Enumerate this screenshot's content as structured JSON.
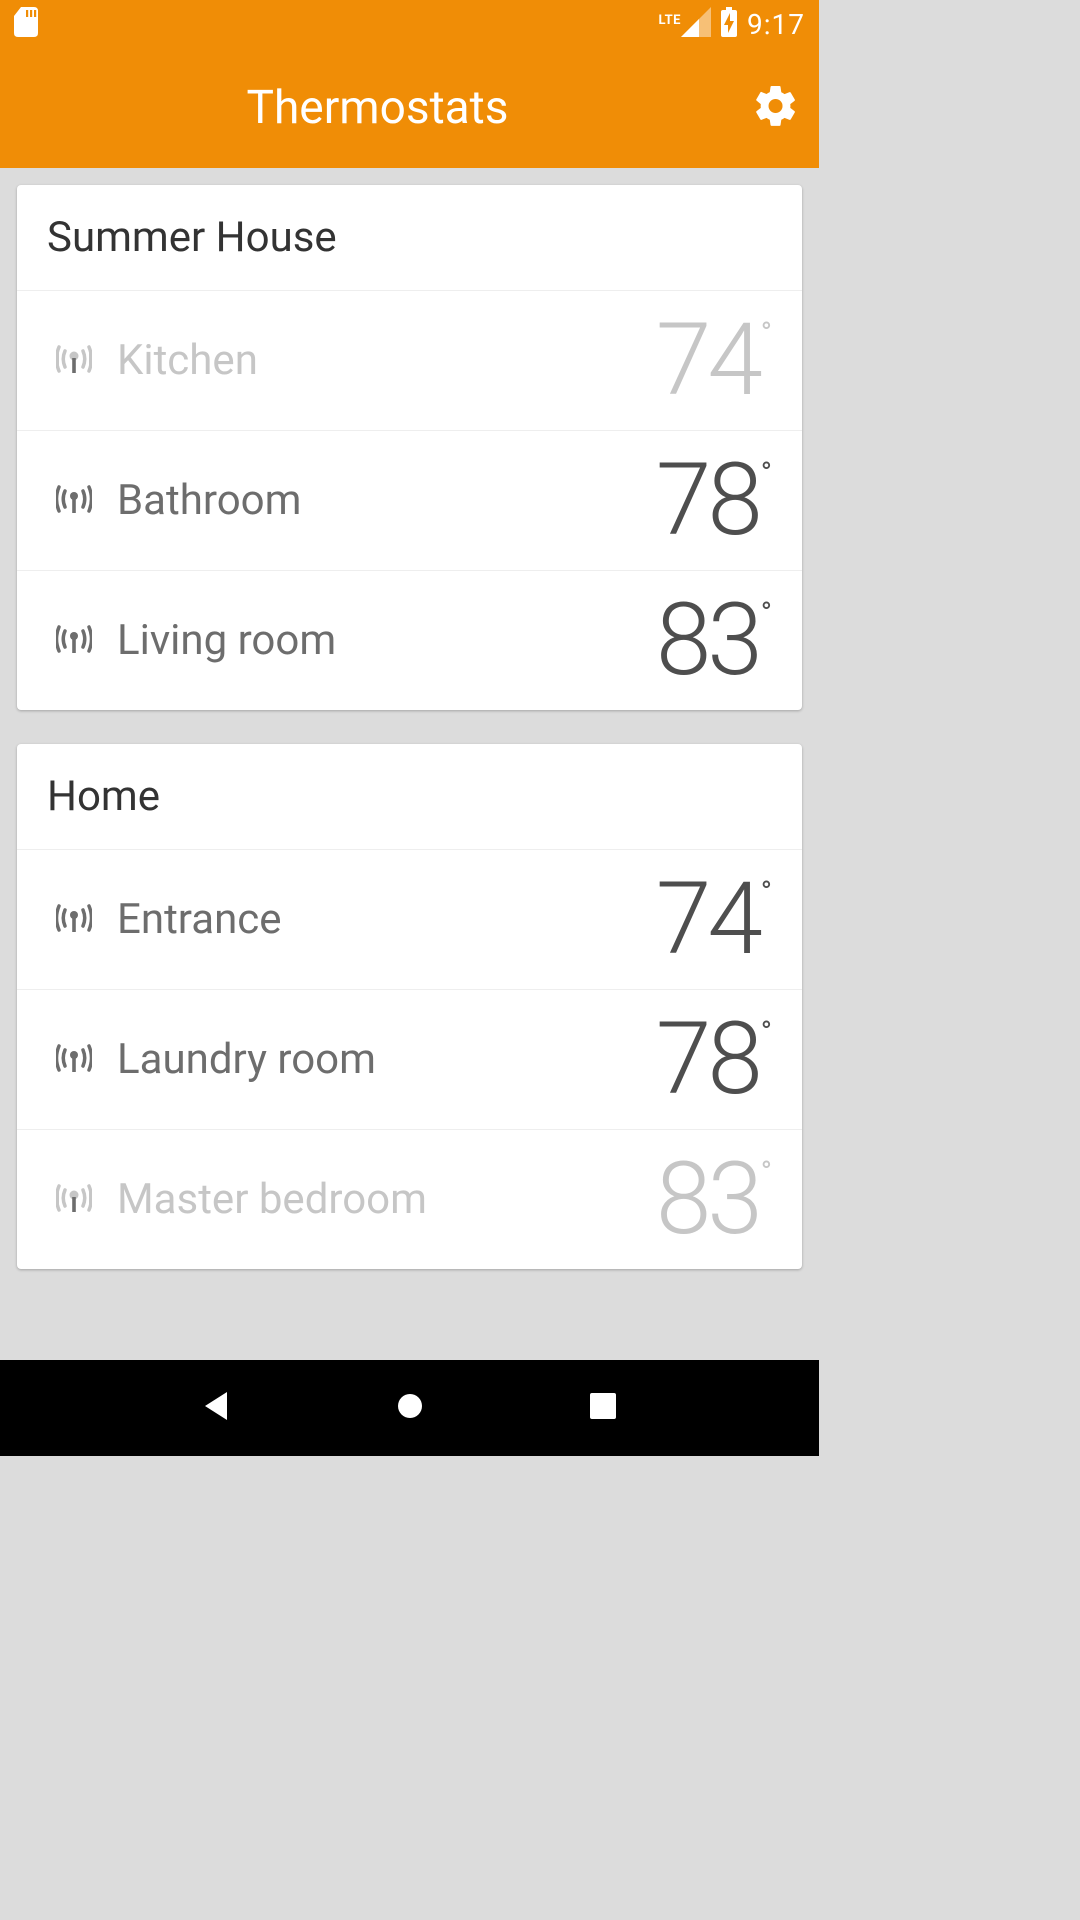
{
  "status_bar": {
    "lte_label": "LTE",
    "time": "9:17"
  },
  "app_bar": {
    "title": "Thermostats",
    "settings_icon": "gear-icon"
  },
  "groups": [
    {
      "title": "Summer House",
      "rooms": [
        {
          "name": "Kitchen",
          "temperature": "74",
          "degree": "°",
          "active": false,
          "icon": "signal-icon"
        },
        {
          "name": "Bathroom",
          "temperature": "78",
          "degree": "°",
          "active": true,
          "icon": "signal-icon"
        },
        {
          "name": "Living room",
          "temperature": "83",
          "degree": "°",
          "active": true,
          "icon": "signal-icon"
        }
      ]
    },
    {
      "title": "Home",
      "rooms": [
        {
          "name": "Entrance",
          "temperature": "74",
          "degree": "°",
          "active": true,
          "icon": "signal-icon"
        },
        {
          "name": "Laundry room",
          "temperature": "78",
          "degree": "°",
          "active": true,
          "icon": "signal-icon"
        },
        {
          "name": "Master bedroom",
          "temperature": "83",
          "degree": "°",
          "active": false,
          "icon": "signal-icon"
        }
      ]
    }
  ],
  "nav": {
    "back": "back-icon",
    "home": "home-icon",
    "recents": "recents-icon"
  },
  "colors": {
    "accent": "#f08d06",
    "text_primary": "#4e4e4e",
    "text_secondary": "#6d6d6d",
    "text_disabled": "#c6c6c6",
    "card_bg": "#ffffff",
    "page_bg": "#dcdcdc"
  }
}
